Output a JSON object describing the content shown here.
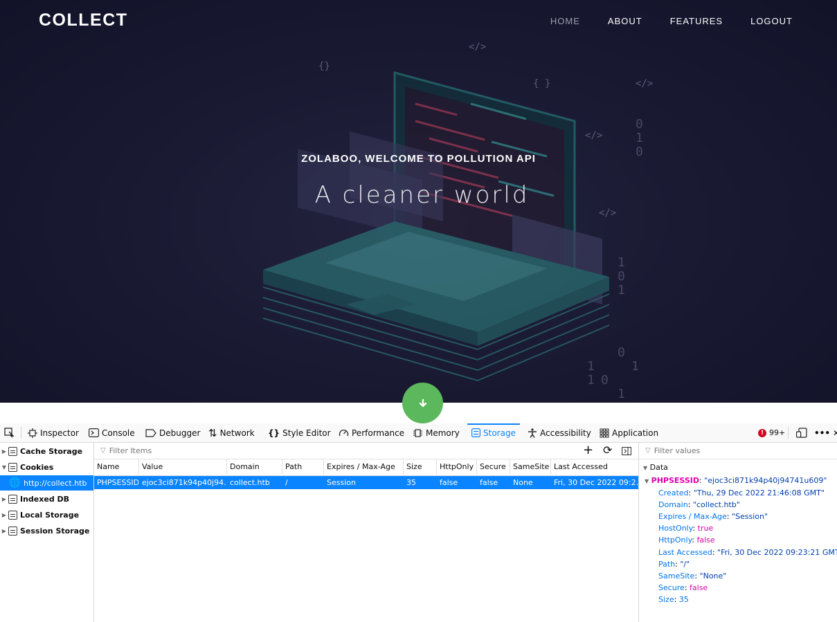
{
  "site": {
    "logo": "COLLECT",
    "nav": [
      "HOME",
      "ABOUT",
      "FEATURES",
      "LOGOUT"
    ],
    "subtitle": "ZOLABOO, WELCOME TO POLLUTION API",
    "headline": "A cleaner world"
  },
  "devtools": {
    "tabs": [
      "Inspector",
      "Console",
      "Debugger",
      "Network",
      "Style Editor",
      "Performance",
      "Memory",
      "Storage",
      "Accessibility",
      "Application"
    ],
    "error_count": "99+",
    "sidebar": {
      "cache": "Cache Storage",
      "cookies": "Cookies",
      "cookie_host": "http://collect.htb",
      "indexed": "Indexed DB",
      "local": "Local Storage",
      "session": "Session Storage"
    },
    "filter_placeholder": "Filter Items",
    "columns": [
      "Name",
      "Value",
      "Domain",
      "Path",
      "Expires / Max-Age",
      "Size",
      "HttpOnly",
      "Secure",
      "SameSite",
      "Last Accessed"
    ],
    "row": [
      "PHPSESSID",
      "ejoc3ci871k94p40j94…",
      "collect.htb",
      "/",
      "Session",
      "35",
      "false",
      "false",
      "None",
      "Fri, 30 Dec 2022 09:2…"
    ],
    "detail": {
      "filter_placeholder": "Filter values",
      "section": "Data",
      "root_key": "PHPSESSID",
      "root_value": "\"ejoc3ci871k94p40j94741u609\"",
      "created_value": "\"Thu, 29 Dec 2022 21:46:08 GMT\"",
      "domain_value": "\"collect.htb\"",
      "expires_value": "\"Session\"",
      "hostonly_value": "true",
      "httponly_value": "false",
      "lastacc_value": "\"Fri, 30 Dec 2022 09:23:21 GMT\"",
      "path_value": "\"/\"",
      "samesite_value": "\"None\"",
      "secure_value": "false",
      "size_value": "35",
      "keys": {
        "created": "Created",
        "domain": "Domain",
        "expires": "Expires / Max-Age",
        "hostonly": "HostOnly",
        "httponly": "HttpOnly",
        "lastacc": "Last Accessed",
        "path": "Path",
        "samesite": "SameSite",
        "secure": "Secure",
        "size": "Size"
      }
    }
  },
  "colors": {
    "accent": "#0a84ff",
    "scroll_button": "#5cb85c",
    "hero_bg": "#1a1a33"
  }
}
